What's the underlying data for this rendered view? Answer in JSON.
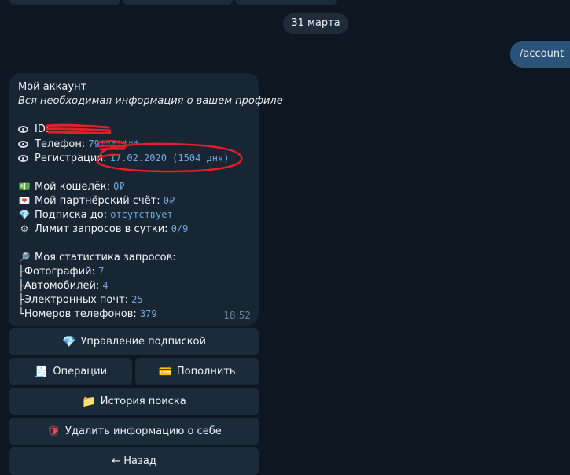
{
  "chat": {
    "date_chip": "31 марта",
    "outgoing_message": "/account"
  },
  "account": {
    "title": "Мой аккаунт",
    "subtitle": "Вся необходимая информация о вашем профиле",
    "id_label": "ID:",
    "phone_label": "Телефон:",
    "phone_value": "79*******",
    "reg_label": "Регистрация:",
    "reg_value": "17.02.2020 (1504 дня)",
    "wallet_label": "Мой кошелёк:",
    "wallet_value": "0₽",
    "partner_label": "Мой партнёрский счёт:",
    "partner_value": "0₽",
    "subscription_label": "Подписка до:",
    "subscription_value": "отсутствует",
    "limit_label": "Лимит запросов в сутки:",
    "limit_value": "0/9",
    "stats_title": "Моя статистика запросов:",
    "stats": [
      {
        "prefix": "├",
        "label": "Фотографий:",
        "value": "7"
      },
      {
        "prefix": "├",
        "label": "Автомобилей:",
        "value": "4"
      },
      {
        "prefix": "├",
        "label": "Электронных почт:",
        "value": "25"
      },
      {
        "prefix": "└",
        "label": "Номеров телефонов:",
        "value": "379"
      }
    ],
    "time": "18:52"
  },
  "keyboard": {
    "manage_subscription": "Управление подпиской",
    "operations": "Операции",
    "top_up": "Пополнить",
    "search_history": "История поиска",
    "delete_info": "Удалить информацию о себе",
    "back": "← Назад"
  },
  "icons": {
    "eye": "eye-icon",
    "wallet": "banknote-icon",
    "partner": "envelope-money-icon",
    "subscription": "gem-icon",
    "limit": "gear-icon",
    "stats": "magnifier-icon",
    "operations": "receipt-icon",
    "top_up": "credit-card-icon",
    "history": "folder-icon",
    "delete": "shield-icon"
  },
  "colors": {
    "background": "#0e1621",
    "bubble": "#182533",
    "outgoing": "#2b5278",
    "link": "#6fa8dc",
    "redaction": "#e0202a"
  }
}
